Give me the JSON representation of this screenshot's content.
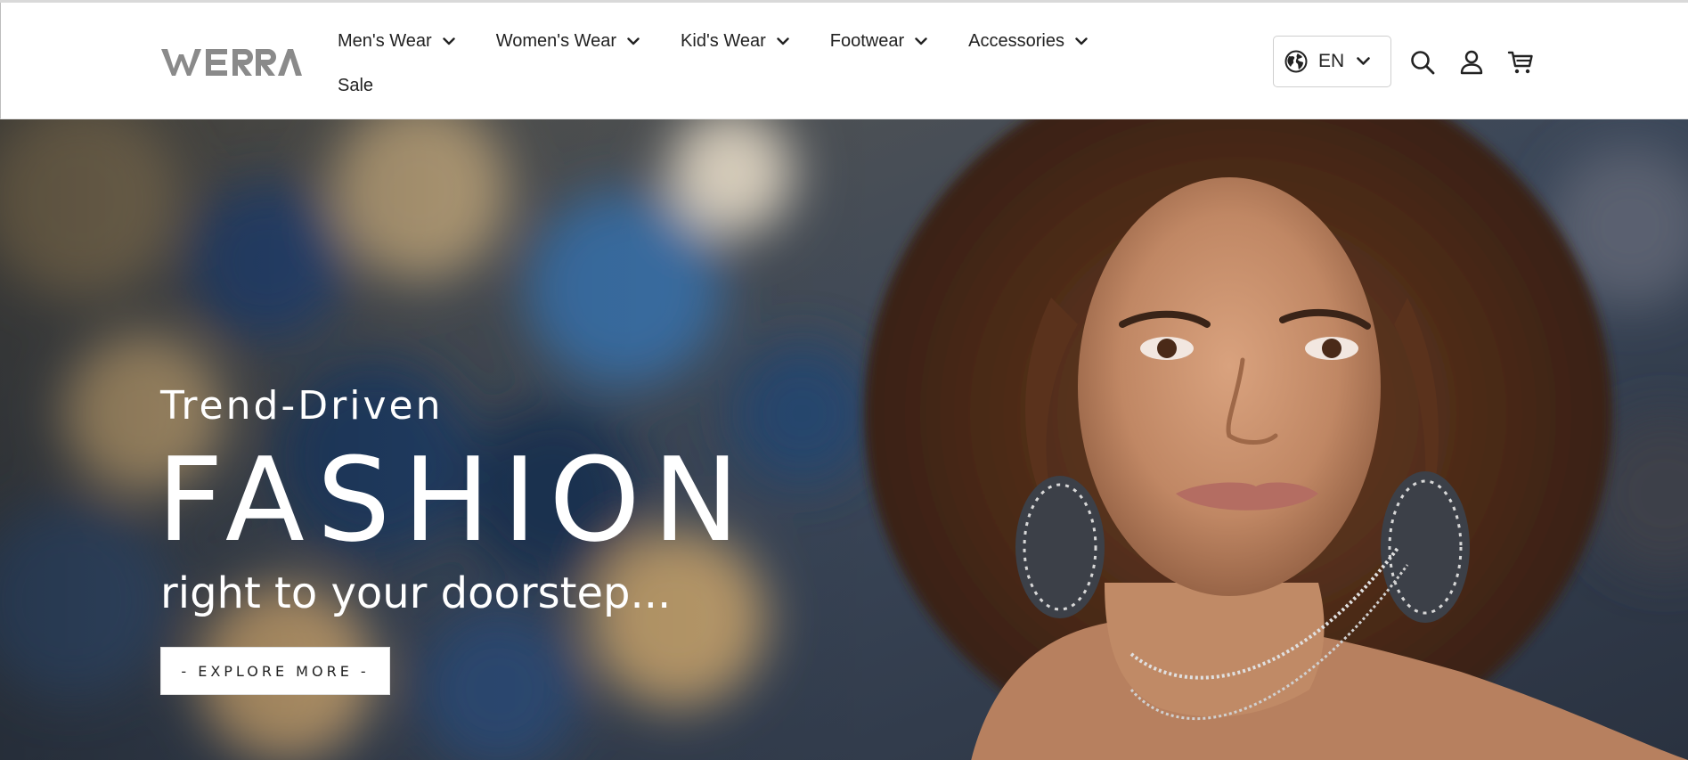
{
  "brand": {
    "logo_text": "WERRA"
  },
  "nav": {
    "row1": [
      {
        "label": "Men's Wear",
        "icon": "chevron-down-icon"
      },
      {
        "label": "Women's Wear",
        "icon": "chevron-down-icon"
      },
      {
        "label": "Kid's Wear",
        "icon": "chevron-down-icon"
      },
      {
        "label": "Footwear",
        "icon": "chevron-down-icon"
      },
      {
        "label": "Accessories",
        "icon": "chevron-down-icon"
      }
    ],
    "row2": [
      {
        "label": "Sale"
      }
    ]
  },
  "header_actions": {
    "language": {
      "code": "EN",
      "icon": "globe-icon"
    },
    "search_icon": "search-icon",
    "account_icon": "user-icon",
    "cart_icon": "cart-icon"
  },
  "hero": {
    "eyebrow": "Trend-Driven",
    "headline": "FASHION",
    "subline": "right to your doorstep...",
    "cta_label": "- EXPLORE MORE -"
  },
  "colors": {
    "text_dark": "#222222",
    "hero_text": "#ffffff",
    "logo_gray": "#8a8a8a"
  }
}
